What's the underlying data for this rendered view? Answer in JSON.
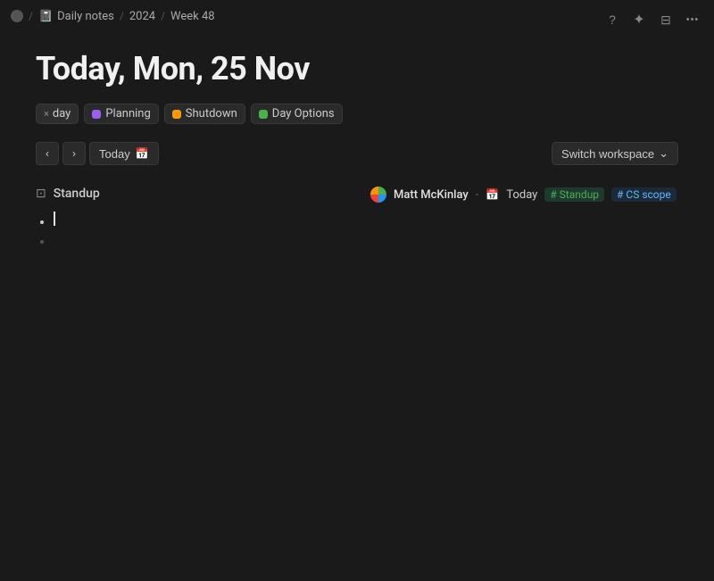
{
  "breadcrumb": {
    "home_icon": "○",
    "separator1": "/",
    "notebook_icon": "📓",
    "section1": "Daily notes",
    "separator2": "/",
    "section2": "2024",
    "separator3": "/",
    "section3": "Week 48"
  },
  "page": {
    "title": "Today, Mon, 25 Nov"
  },
  "tags": {
    "close_tag_label": "day",
    "tag1_label": "Planning",
    "tag1_color": "#9c5cf5",
    "tag2_label": "Shutdown",
    "tag2_color": "#ff9800",
    "tag3_label": "Day Options",
    "tag3_color": "#4caf50"
  },
  "toolbar": {
    "today_label": "Today",
    "switch_workspace_label": "Switch workspace",
    "chevron": "∨"
  },
  "left_panel": {
    "section_title": "Standup",
    "section_icon": "⊡",
    "empty_bullet": ""
  },
  "right_panel": {
    "user_name": "Matt McKinlay",
    "separator": "-",
    "date_label": "Today",
    "tag1": "Standup",
    "tag2": "CS scope"
  },
  "icons": {
    "question": "?",
    "sparkle": "✦",
    "sliders": "⊟",
    "more": "•••",
    "chevron_left": "‹",
    "chevron_right": "›",
    "calendar": "📅",
    "chevron_down": "⌄"
  }
}
